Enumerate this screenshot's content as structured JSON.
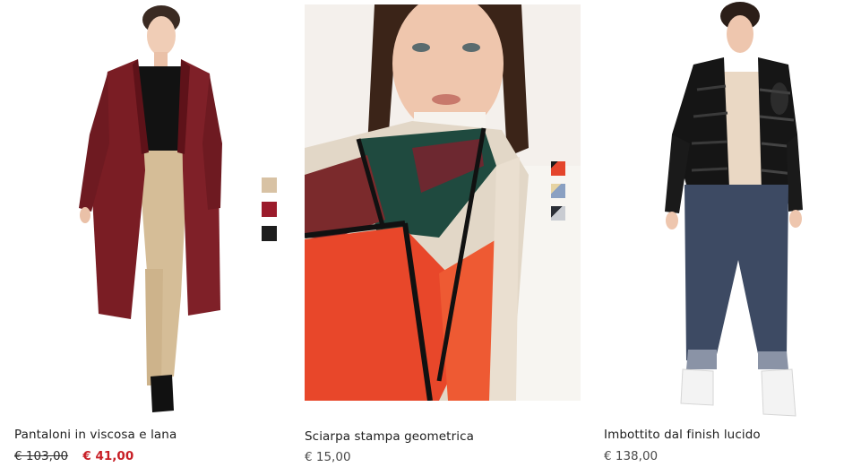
{
  "products": [
    {
      "name": "Pantaloni in viscosa e lana",
      "price_old": "€ 103,00",
      "price_sale": "€ 41,00",
      "image_subject": "model-in-burgundy-coat",
      "swatches": [
        "#d8c2a4",
        "#9b1b2b",
        "#1d1d1d"
      ]
    },
    {
      "name": "Sciarpa stampa geometrica",
      "price": "€ 15,00",
      "image_subject": "model-with-geometric-scarf",
      "swatches": [
        "#e4452c",
        "#8aa0c2",
        "#6e7785"
      ]
    },
    {
      "name": "Imbottito dal finish lucido",
      "price": "€ 138,00",
      "image_subject": "model-in-black-puffer-jacket"
    }
  ]
}
